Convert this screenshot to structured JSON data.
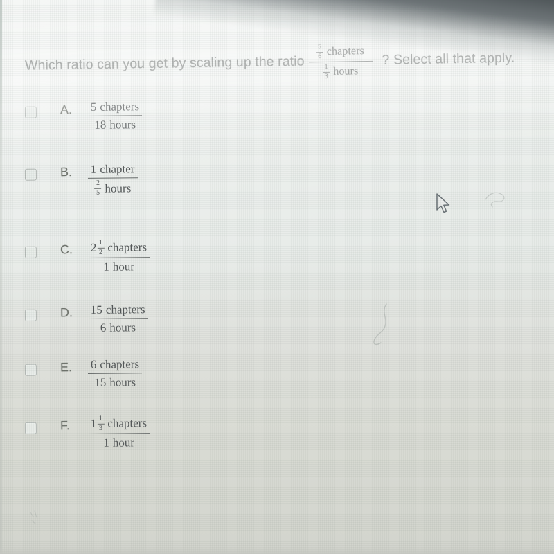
{
  "question": {
    "text_before": "Which ratio can you get by scaling up the ratio",
    "text_after": "? Select all that apply.",
    "ratio": {
      "numerator_fraction": {
        "top": "5",
        "bottom": "6"
      },
      "numerator_unit": "chapters",
      "denominator_fraction": {
        "top": "1",
        "bottom": "3"
      },
      "denominator_unit": "hours"
    }
  },
  "options": [
    {
      "letter": "A.",
      "checked": false,
      "numerator": {
        "whole": "5",
        "unit": "chapters"
      },
      "denominator": {
        "whole": "18",
        "unit": "hours"
      }
    },
    {
      "letter": "B.",
      "checked": false,
      "numerator": {
        "whole": "1",
        "unit": "chapter"
      },
      "denominator": {
        "fraction": {
          "top": "2",
          "bottom": "5"
        },
        "unit": "hours"
      }
    },
    {
      "letter": "C.",
      "checked": false,
      "numerator": {
        "whole": "2",
        "fraction": {
          "top": "1",
          "bottom": "2"
        },
        "unit": "chapters"
      },
      "denominator": {
        "whole": "1",
        "unit": "hour"
      }
    },
    {
      "letter": "D.",
      "checked": false,
      "numerator": {
        "whole": "15",
        "unit": "chapters"
      },
      "denominator": {
        "whole": "6",
        "unit": "hours"
      }
    },
    {
      "letter": "E.",
      "checked": false,
      "numerator": {
        "whole": "6",
        "unit": "chapters"
      },
      "denominator": {
        "whole": "15",
        "unit": "hours"
      }
    },
    {
      "letter": "F.",
      "checked": false,
      "numerator": {
        "whole": "1",
        "fraction": {
          "top": "1",
          "bottom": "3"
        },
        "unit": "chapters"
      },
      "denominator": {
        "whole": "1",
        "unit": "hour"
      }
    }
  ],
  "cursor": {
    "icon": "arrow-pointer-cursor"
  },
  "colors": {
    "background": "#e3e7e4",
    "question_text": "#6f7371",
    "option_text": "#55595a",
    "checkbox_border": "#b0b6b2",
    "bezel": "#2f3538"
  }
}
